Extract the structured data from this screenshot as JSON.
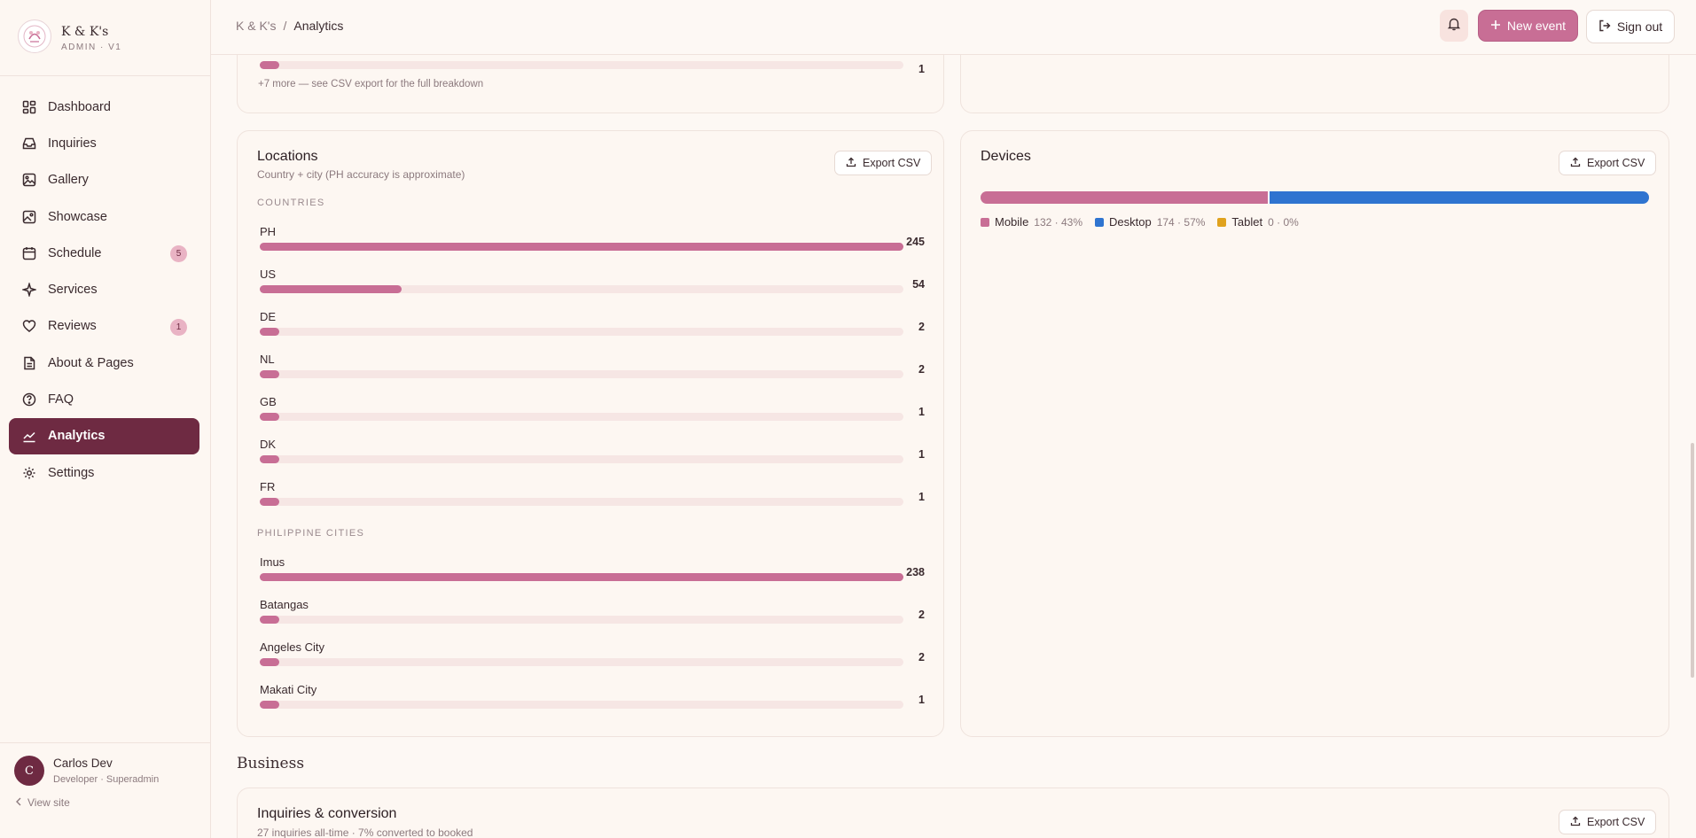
{
  "brand": {
    "name": "K & K's",
    "sub": "ADMIN · V1"
  },
  "nav": {
    "items": [
      {
        "label": "Dashboard",
        "badge": null
      },
      {
        "label": "Inquiries",
        "badge": null
      },
      {
        "label": "Gallery",
        "badge": null
      },
      {
        "label": "Showcase",
        "badge": null
      },
      {
        "label": "Schedule",
        "badge": "5"
      },
      {
        "label": "Services",
        "badge": null
      },
      {
        "label": "Reviews",
        "badge": "1"
      },
      {
        "label": "About & Pages",
        "badge": null
      },
      {
        "label": "FAQ",
        "badge": null
      },
      {
        "label": "Analytics",
        "badge": null
      },
      {
        "label": "Settings",
        "badge": null
      }
    ],
    "active": "Analytics"
  },
  "user": {
    "initial": "C",
    "name": "Carlos Dev",
    "role": "Developer · Superadmin",
    "view_site": "View site"
  },
  "topbar": {
    "breadcrumb_root": "K & K's",
    "breadcrumb_sep": "/",
    "breadcrumb_current": "Analytics",
    "new_event": "New event",
    "sign_out": "Sign out"
  },
  "prev_card": {
    "partial_value": "1",
    "partial_pct": 3,
    "more_note": "+7 more — see CSV export for the full breakdown"
  },
  "locations": {
    "title": "Locations",
    "subtitle": "Country + city (PH accuracy is approximate)",
    "export_label": "Export CSV",
    "countries_label": "COUNTRIES",
    "countries": [
      {
        "label": "PH",
        "value": "245",
        "pct": 100
      },
      {
        "label": "US",
        "value": "54",
        "pct": 22
      },
      {
        "label": "DE",
        "value": "2",
        "pct": 3
      },
      {
        "label": "NL",
        "value": "2",
        "pct": 3
      },
      {
        "label": "GB",
        "value": "1",
        "pct": 3
      },
      {
        "label": "DK",
        "value": "1",
        "pct": 3
      },
      {
        "label": "FR",
        "value": "1",
        "pct": 3
      }
    ],
    "cities_label": "PHILIPPINE CITIES",
    "cities": [
      {
        "label": "Imus",
        "value": "238",
        "pct": 100
      },
      {
        "label": "Batangas",
        "value": "2",
        "pct": 3
      },
      {
        "label": "Angeles City",
        "value": "2",
        "pct": 3
      },
      {
        "label": "Makati City",
        "value": "1",
        "pct": 3
      }
    ]
  },
  "devices": {
    "title": "Devices",
    "export_label": "Export CSV",
    "segments": [
      {
        "name": "Mobile",
        "value": "132 · 43%",
        "pct": 43,
        "color": "#c86e95"
      },
      {
        "name": "Desktop",
        "value": "174 · 57%",
        "pct": 57,
        "color": "#2f74d0"
      },
      {
        "name": "Tablet",
        "value": "0 · 0%",
        "pct": 0,
        "color": "#e0a21e"
      }
    ]
  },
  "business": {
    "heading": "Business",
    "card_title": "Inquiries & conversion",
    "card_sub": "27 inquiries all-time · 7% converted to booked",
    "export_label": "Export CSV"
  }
}
